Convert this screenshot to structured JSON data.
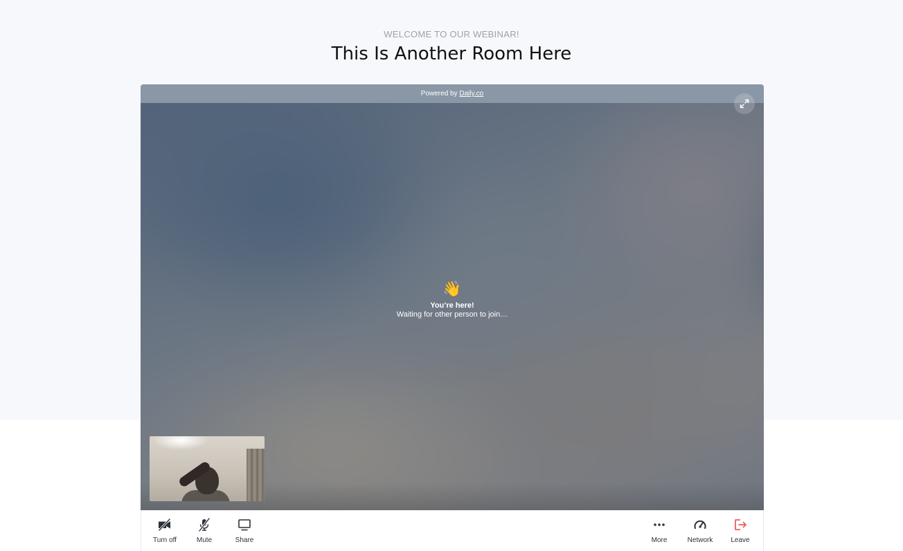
{
  "header": {
    "subtitle": "WELCOME TO OUR WEBINAR!",
    "title": "This Is Another Room Here"
  },
  "call": {
    "powered_prefix": "Powered by ",
    "powered_link": "Daily.co",
    "waiting_emoji": "👋",
    "waiting_title": "You’re here!",
    "waiting_text": "Waiting for other person to join…"
  },
  "toolbar": {
    "left": [
      {
        "label": "Turn off",
        "icon": "camera-off-icon"
      },
      {
        "label": "Mute",
        "icon": "mic-off-icon"
      },
      {
        "label": "Share",
        "icon": "screen-share-icon"
      }
    ],
    "right": [
      {
        "label": "More",
        "icon": "more-icon"
      },
      {
        "label": "Network",
        "icon": "network-icon"
      },
      {
        "label": "Leave",
        "icon": "leave-icon"
      }
    ]
  },
  "colors": {
    "page_background": "#f7f8fc",
    "powered_bar": "#8a97a7",
    "toolbar_text": "#2b3038",
    "leave_accent": "#f25a5a"
  }
}
